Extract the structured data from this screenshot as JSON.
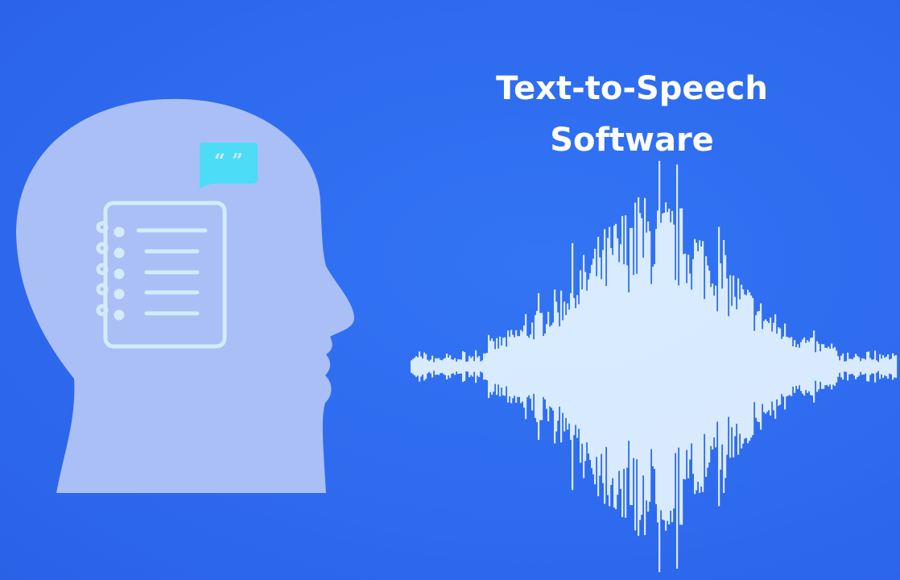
{
  "title": {
    "line1": "Text-to-Speech",
    "line2": "Software"
  },
  "quote_glyph": "“ ”",
  "colors": {
    "background": "#2f6cf0",
    "head": "#a9bff6",
    "notebook": "#d4ebfb",
    "bubble": "#4ddcf5",
    "wave": "#e6f4ff"
  }
}
